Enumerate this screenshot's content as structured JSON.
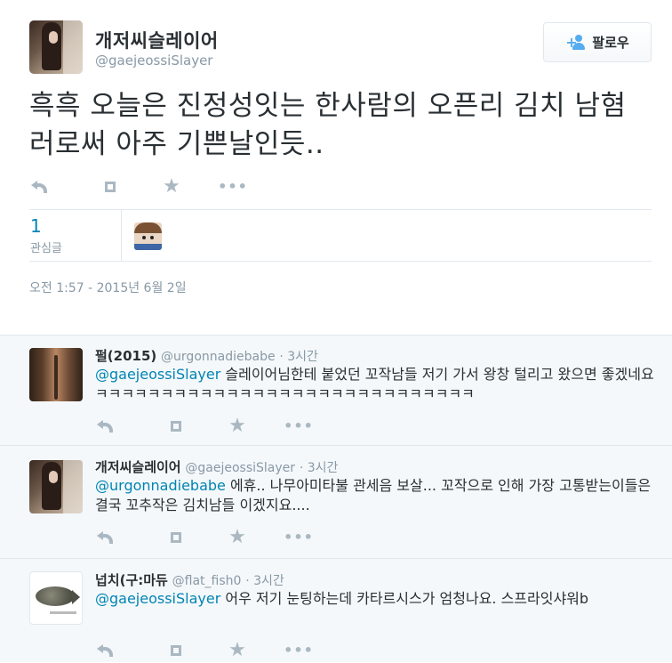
{
  "tweet": {
    "author_name": "개저씨슬레이어",
    "author_handle": "@gaejeossiSlayer",
    "follow_label": "팔로우",
    "text": "흑흑 오늘은 진정성잇는 한사람의 오픈리 김치 남혐러로써 아주 기쁜날인듯..",
    "favorites_count": "1",
    "favorites_label": "관심글",
    "timestamp": "오전 1:57 - 2015년 6월 2일",
    "actions": {
      "reply_icon": "reply-icon",
      "retweet_icon": "retweet-icon",
      "favorite_icon": "star-icon",
      "more_icon": "more-icon"
    }
  },
  "replies": [
    {
      "name": "펄(2015)",
      "handle": "@urgonnadiebabe",
      "time": "· 3시간",
      "mention": "@gaejeossiSlayer",
      "text": " 슬레이어님한테 붙었던 꼬작남들 저기 가서 왕창 털리고 왔으면 좋겠네요ㅋㅋㅋㅋㅋㅋㅋㅋㅋㅋㅋㅋㅋㅋㅋㅋㅋㅋㅋㅋㅋㅋㅋㅋㅋㅋㅋㅋㅋ"
    },
    {
      "name": "개저씨슬레이어",
      "handle": "@gaejeossiSlayer",
      "time": "· 3시간",
      "mention": "@urgonnadiebabe",
      "text": " 에휴.. 나무아미타불 관세음 보살... 꼬작으로 인해 가장 고통받는이들은 결국 꼬추작은 김치남들 이겠지요...."
    },
    {
      "name": "넙치(구:마듀",
      "handle": "@flat_fish0",
      "time": "· 3시간",
      "mention": "@gaejeossiSlayer",
      "text": " 어우 저기 눈팅하는데 카타르시스가 엄청나요. 스프라잇샤워b"
    }
  ],
  "colors": {
    "link": "#0084b4",
    "follow_icon": "#55acee",
    "muted": "#8899a6",
    "reply_bg": "#f5f8fa"
  }
}
